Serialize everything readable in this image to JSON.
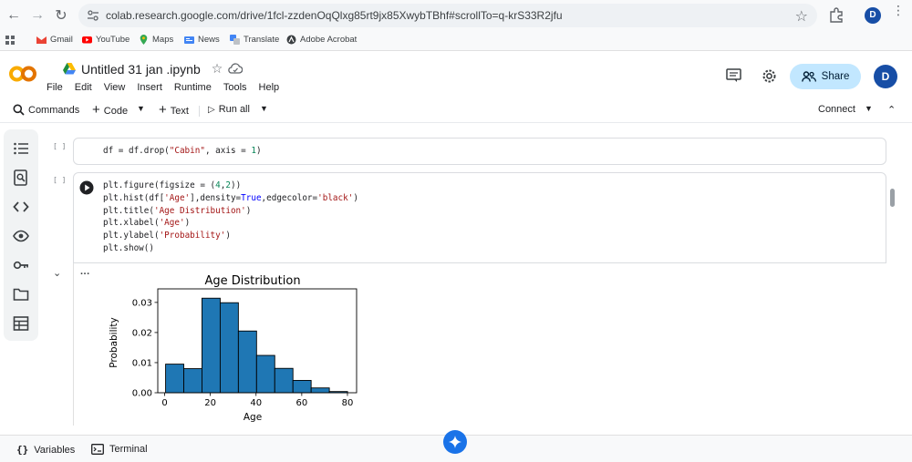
{
  "browser": {
    "url": "colab.research.google.com/drive/1fcl-zzdenOqQlxg85rt9jx85XwybTBhf#scrollTo=q-krS33R2jfu",
    "profile_initial": "D"
  },
  "bookmarks": [
    {
      "label": "Gmail",
      "icon": "gmail-icon"
    },
    {
      "label": "YouTube",
      "icon": "youtube-icon"
    },
    {
      "label": "Maps",
      "icon": "maps-icon"
    },
    {
      "label": "News",
      "icon": "news-icon"
    },
    {
      "label": "Translate",
      "icon": "translate-icon"
    },
    {
      "label": "Adobe Acrobat",
      "icon": "acrobat-icon"
    }
  ],
  "notebook": {
    "title": "Untitled 31 jan .ipynb",
    "menus": [
      "File",
      "Edit",
      "View",
      "Insert",
      "Runtime",
      "Tools",
      "Help"
    ],
    "share_label": "Share",
    "avatar_initial": "D"
  },
  "toolbar": {
    "commands": "Commands",
    "code": "Code",
    "text": "Text",
    "run_all": "Run all",
    "connect": "Connect"
  },
  "cells": {
    "cell1_bracket": "[ ]",
    "cell2_bracket": "[ ]",
    "output_dots": "..."
  },
  "footer": {
    "variables": "Variables",
    "terminal": "Terminal"
  },
  "colors": {
    "bar_fill": "#1f77b4",
    "share_bg": "#c2e7ff",
    "accent": "#1a73e8"
  },
  "chart_data": {
    "type": "bar",
    "title": "Age Distribution",
    "xlabel": "Age",
    "ylabel": "Probability",
    "xlim": [
      -3,
      84
    ],
    "ylim": [
      0,
      0.0345
    ],
    "xticks": [
      0,
      20,
      40,
      60,
      80
    ],
    "xtick_labels": [
      "0",
      "20",
      "40",
      "60",
      "80"
    ],
    "yticks": [
      0,
      0.01,
      0.02,
      0.03
    ],
    "ytick_labels": [
      "0.00",
      "0.01",
      "0.02",
      "0.03"
    ],
    "bin_edges": [
      0.42,
      8.38,
      16.34,
      24.31,
      32.27,
      40.23,
      48.19,
      56.15,
      64.11,
      72.08,
      80.04
    ],
    "values": [
      0.0095,
      0.008,
      0.0314,
      0.0299,
      0.0205,
      0.0124,
      0.0081,
      0.0041,
      0.0016,
      0.0004
    ],
    "grid": false
  }
}
